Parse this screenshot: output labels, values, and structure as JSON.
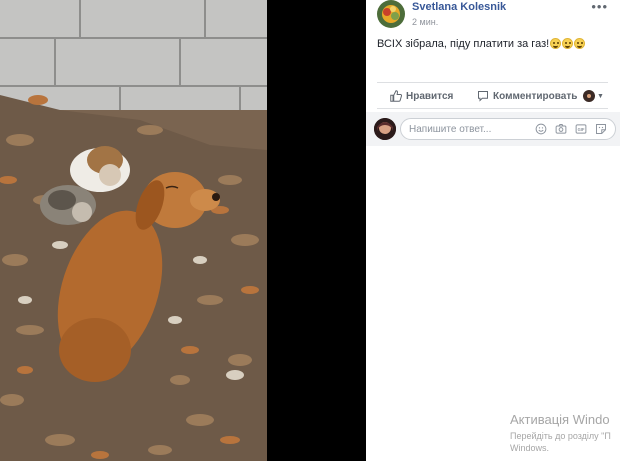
{
  "post": {
    "author": "Svetlana Kolesnik",
    "time": "2 мин.",
    "text": "ВСІХ зібрала, піду платити за газ!",
    "emojis": [
      "smile-emoji",
      "smile-emoji",
      "smile-emoji"
    ]
  },
  "actions": {
    "like_label": "Нравится",
    "comment_label": "Комментировать"
  },
  "reply": {
    "placeholder": "Напишите ответ..."
  },
  "watermark": {
    "title": "Активація Windo",
    "line1": "Перейдіть до розділу \"П",
    "line2": "Windows."
  },
  "icons": {
    "more": "more-dots-icon",
    "like": "thumbs-up-icon",
    "comment": "comment-bubble-icon",
    "emoji": "smiley-icon",
    "camera": "camera-icon",
    "gif": "gif-icon",
    "sticker": "sticker-icon"
  },
  "colors": {
    "author_link": "#385898",
    "secondary_text": "#90949c",
    "divider": "#dddfe2",
    "reply_bg": "#f2f3f5"
  }
}
